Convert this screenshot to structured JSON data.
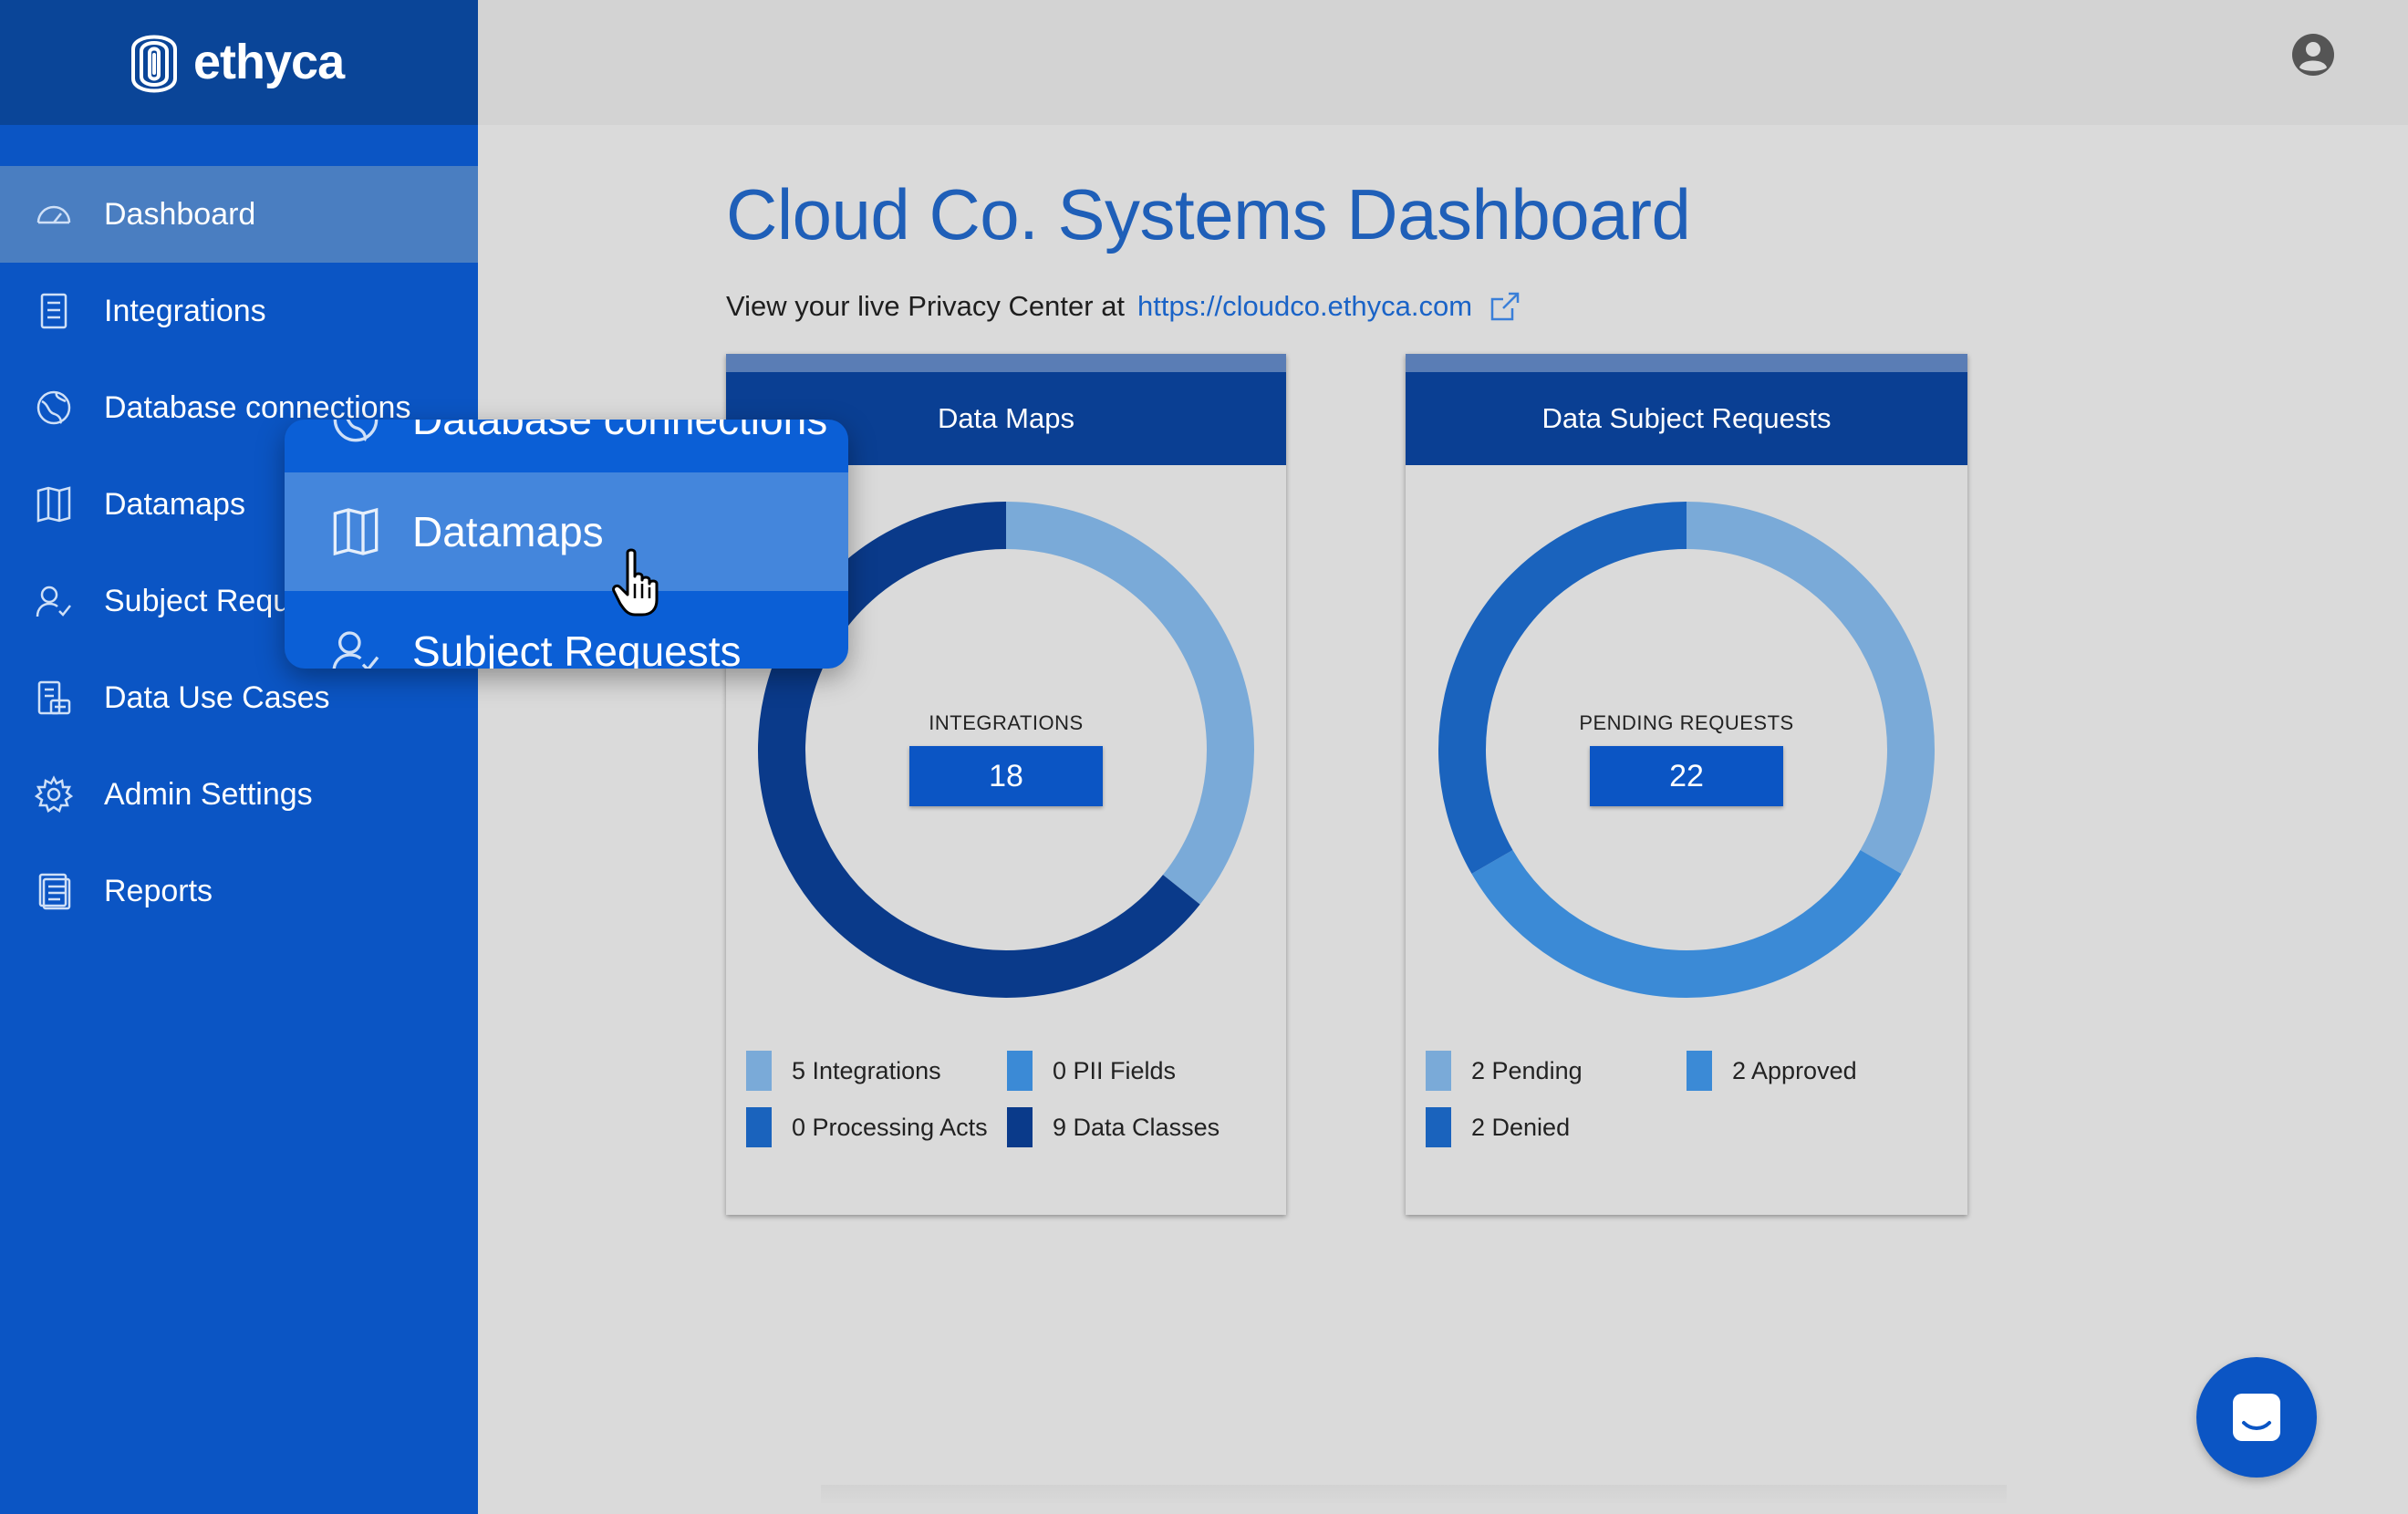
{
  "brand": {
    "name": "ethyca",
    "logo_icon": "fingerprint-icon"
  },
  "sidebar": {
    "items": [
      {
        "label": "Dashboard",
        "icon": "speedometer-icon",
        "active": true
      },
      {
        "label": "Integrations",
        "icon": "document-list-icon",
        "active": false
      },
      {
        "label": "Database connections",
        "icon": "globe-icon",
        "active": false
      },
      {
        "label": "Datamaps",
        "icon": "map-icon",
        "active": false
      },
      {
        "label": "Subject Requests",
        "icon": "user-check-icon",
        "active": false
      },
      {
        "label": "Data Use Cases",
        "icon": "data-usecase-icon",
        "active": false
      },
      {
        "label": "Admin Settings",
        "icon": "gear-icon",
        "active": false
      },
      {
        "label": "Reports",
        "icon": "report-icon",
        "active": false
      }
    ]
  },
  "popup": {
    "top_label": "Database connections",
    "mid_label": "Datamaps",
    "bottom_label": "Subject Requests"
  },
  "header": {
    "avatar_icon": "user-circle-icon"
  },
  "main": {
    "title": "Cloud Co. Systems Dashboard",
    "subline_text": "View your live Privacy Center at",
    "link_text": "https://cloudco.ethyca.com"
  },
  "cards": {
    "data_maps": {
      "title": "Data Maps",
      "center_label": "INTEGRATIONS",
      "center_value": "18",
      "legend": [
        {
          "label": "5 Integrations",
          "color": "#7aaad8"
        },
        {
          "label": "0 PII Fields",
          "color": "#3b8ad6"
        },
        {
          "label": "0 Processing Acts",
          "color": "#1a63bd"
        },
        {
          "label": "9 Data Classes",
          "color": "#0a3a8a"
        }
      ]
    },
    "dsr": {
      "title": "Data Subject Requests",
      "center_label": "PENDING REQUESTS",
      "center_value": "22",
      "legend": [
        {
          "label": "2 Pending",
          "color": "#7aaad8"
        },
        {
          "label": "2 Approved",
          "color": "#3b8ad6"
        },
        {
          "label": "2 Denied",
          "color": "#1a63bd"
        }
      ]
    }
  },
  "chart_data": [
    {
      "type": "pie",
      "title": "Data Maps",
      "categories": [
        "Integrations",
        "PII Fields",
        "Processing Acts",
        "Data Classes"
      ],
      "values": [
        5,
        0,
        0,
        9
      ],
      "colors": [
        "#7aaad8",
        "#3b8ad6",
        "#1a63bd",
        "#0a3a8a"
      ]
    },
    {
      "type": "pie",
      "title": "Data Subject Requests",
      "categories": [
        "Pending",
        "Approved",
        "Denied"
      ],
      "values": [
        2,
        2,
        2
      ],
      "colors": [
        "#7aaad8",
        "#3b8ad6",
        "#1a63bd"
      ]
    }
  ]
}
